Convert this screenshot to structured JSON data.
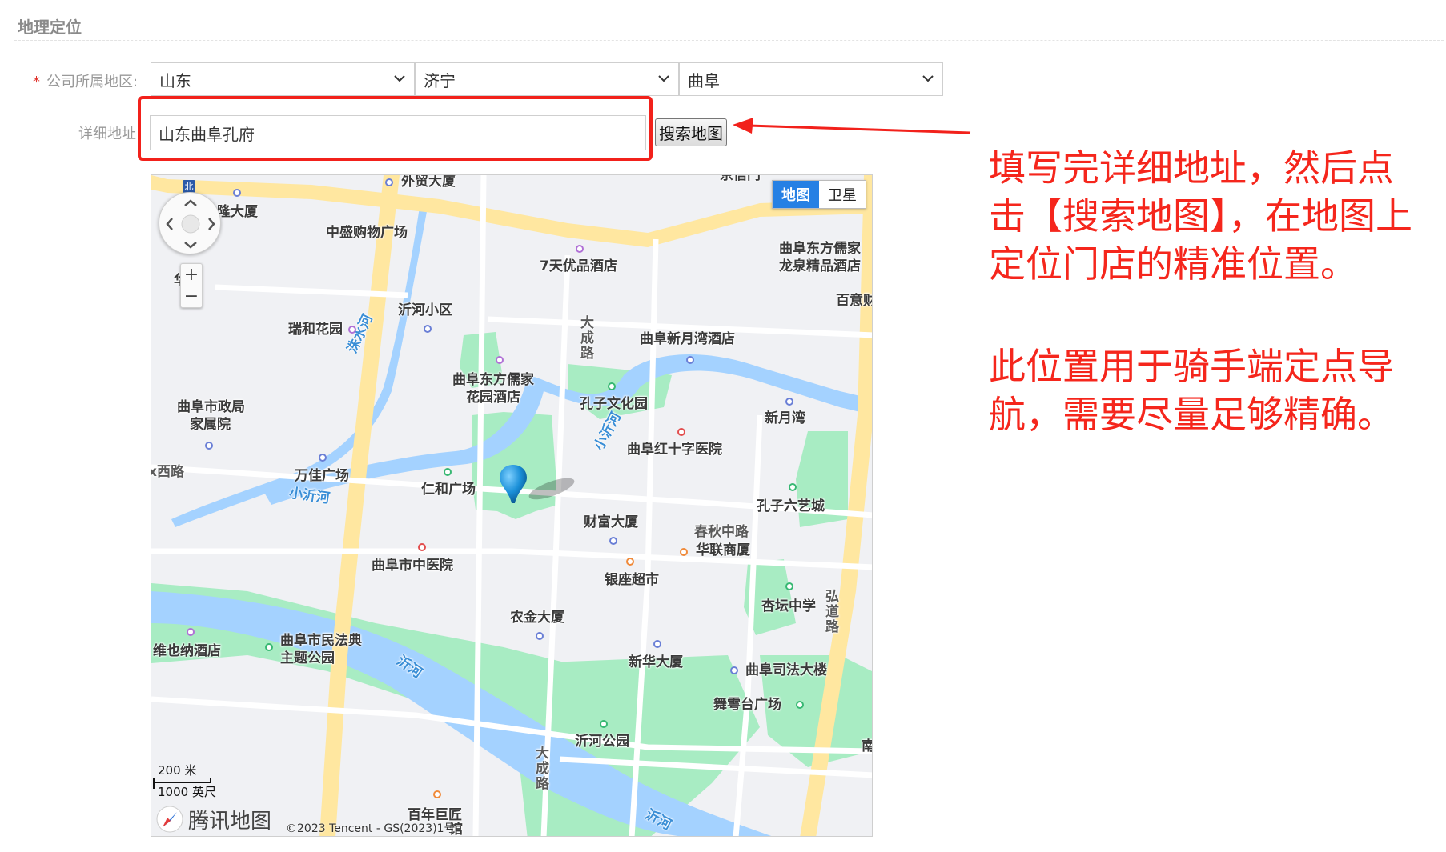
{
  "section": {
    "title": "地理定位"
  },
  "form": {
    "region_label": "公司所属地区:",
    "required_mark": "*",
    "province": "山东",
    "city": "济宁",
    "district": "曲阜",
    "address_label": "详细地址",
    "address_value": "山东曲阜孔府",
    "search_button": "搜索地图"
  },
  "annotation": {
    "line1": "填写完详细地址，然后点击【搜索地图】，在地图上定位门店的精准位置。",
    "line2": "此位置用于骑手端定点导航，需要尽量足够精确。",
    "color": "#f5261c"
  },
  "map": {
    "type_map": "地图",
    "type_satellite": "卫星",
    "zoom_in": "+",
    "zoom_out": "−",
    "north": "北",
    "scale_metric": "200 米",
    "scale_imperial": "1000 英尺",
    "brand": "腾讯地图",
    "copyright": "©2023 Tencent - GS(2023)1号",
    "pois": {
      "waimao": "外贸大厦",
      "zongbu_top": "京信门",
      "longsha": "隆大厦",
      "zhongsheng": "中盛购物广场",
      "qitian": "7天优品酒店",
      "dongfang_longquan_1": "曲阜东方儒家",
      "dongfang_longquan_2": "龙泉精品酒店",
      "baiyi": "百意财",
      "huayuan": "华苑",
      "yihe_xiaoqu": "沂河小区",
      "ruihe": "瑞和花园",
      "xinyuewan_hotel": "曲阜新月湾酒店",
      "huayuan_hotel_1": "曲阜东方儒家",
      "huayuan_hotel_2": "花园酒店",
      "kongzi_wenhua": "孔子文化园",
      "gov_1": "曲阜市政局",
      "gov_2": "家属院",
      "xinyuewan": "新月湾",
      "red_cross": "曲阜红十字医院",
      "west_road": "x西路",
      "wanjia": "万佳广场",
      "renhe": "仁和广场",
      "liuyi": "孔子六艺城",
      "caifu": "财富大厦",
      "chunqiu": "春秋中路",
      "hualian": "华联商厦",
      "tcm": "曲阜市中医院",
      "yinzuo": "银座超市",
      "xingtan": "杏坛中学",
      "hongdao": "弘道路",
      "nongjin": "农金大厦",
      "weiyena": "维也纳酒店",
      "park_1": "曲阜市民法典",
      "park_2": "主题公园",
      "xinhua": "新华大厦",
      "sifa": "曲阜司法大楼",
      "wuyutai": "舞雩台广场",
      "yihe_park": "沂河公园",
      "nan": "南",
      "baiqian": "百年巨匠",
      "guan": "馆",
      "dacheng_road": "大成路",
      "dacheng_road_s": "大成路",
      "zhushui_river": "洙水河",
      "xiaoyi_river": "小沂河",
      "xiaoyi_river_n": "小沂河",
      "yi_river": "沂河",
      "yi_river_s": "沂河"
    }
  }
}
